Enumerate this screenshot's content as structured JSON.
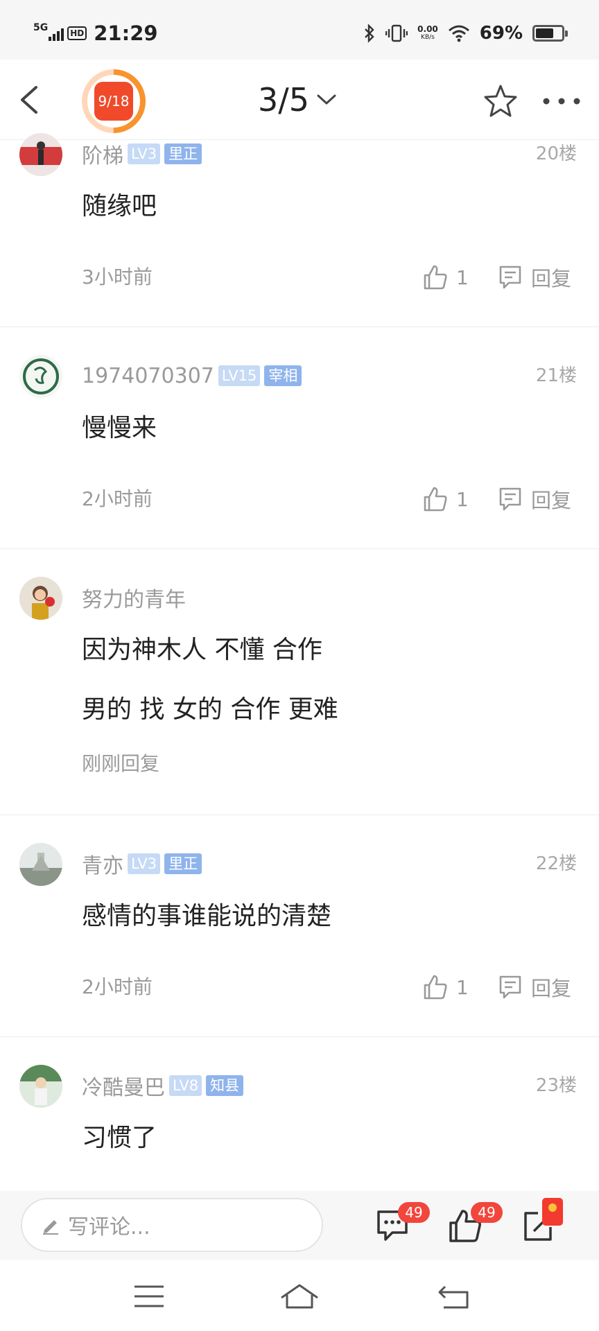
{
  "status_bar": {
    "network": "5G",
    "hd": "HD",
    "time": "21:29",
    "speed_value": "0.00",
    "speed_unit": "KB/s",
    "battery_pct": "69%",
    "battery_level": 0.69
  },
  "top_nav": {
    "progress_text": "9/18",
    "progress_fraction": 0.5,
    "page_indicator": "3/5"
  },
  "comments": [
    {
      "username": "阶梯",
      "level": "LV3",
      "title": "里正",
      "floor": "20楼",
      "content": [
        "随缘吧"
      ],
      "time": "3小时前",
      "likes": "1",
      "reply_label": "回复"
    },
    {
      "username": "1974070307",
      "level": "LV15",
      "title": "宰相",
      "floor": "21楼",
      "content": [
        "慢慢来"
      ],
      "time": "2小时前",
      "likes": "1",
      "reply_label": "回复"
    },
    {
      "username": "努力的青年",
      "content": [
        "因为神木人 不懂 合作",
        "男的 找 女的 合作 更难"
      ],
      "time": "刚刚回复"
    },
    {
      "username": "青亦",
      "level": "LV3",
      "title": "里正",
      "floor": "22楼",
      "content": [
        "感情的事谁能说的清楚"
      ],
      "time": "2小时前",
      "likes": "1",
      "reply_label": "回复"
    },
    {
      "username": "冷酷曼巴",
      "level": "LV8",
      "title": "知县",
      "floor": "23楼",
      "content": [
        "习惯了"
      ]
    }
  ],
  "comment_bar": {
    "placeholder": "写评论...",
    "comments_count": "49",
    "likes_count": "49"
  },
  "icons": [
    "back-arrow-icon",
    "star-icon",
    "more-icon",
    "thumbs-up-icon",
    "reply-icon",
    "pencil-icon",
    "comment-icon",
    "like-icon",
    "share-icon",
    "menu-icon",
    "home-icon",
    "return-icon"
  ],
  "colors": {
    "accent": "#f04a2a",
    "level_badge": "#c6daf6",
    "title_badge": "#8fb4ec",
    "count_badge": "#f2463c"
  }
}
